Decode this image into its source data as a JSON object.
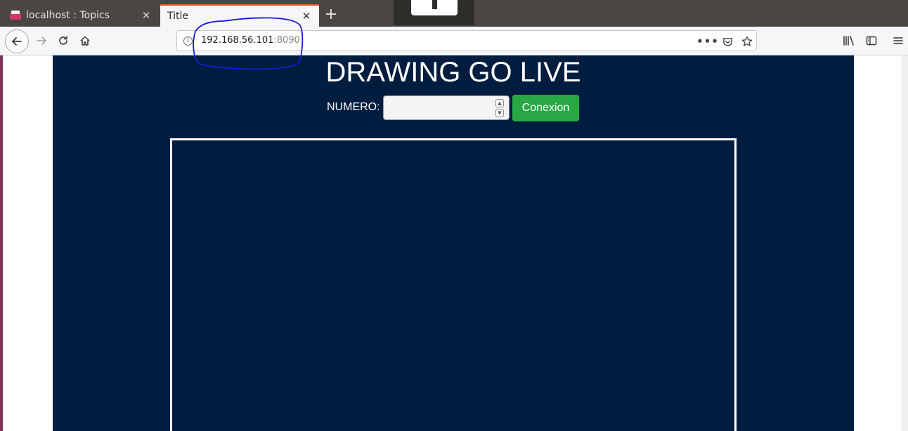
{
  "browser": {
    "tabs": [
      {
        "title": "localhost : Topics",
        "icon": "topics-favicon-icon"
      },
      {
        "title": "Title"
      }
    ],
    "url": {
      "host": "192.168.56.101",
      "port": ":8090"
    },
    "accent_color": "#e95420"
  },
  "page": {
    "heading": "DRAWING GO LIVE",
    "numero_label": "NUMERO:",
    "numero_value": "",
    "connect_label": "Conexion",
    "background_color": "#001d3f",
    "button_color": "#28a745"
  },
  "annotation": {
    "color": "#1a1ad6",
    "shape": "hand-drawn circle around url"
  }
}
